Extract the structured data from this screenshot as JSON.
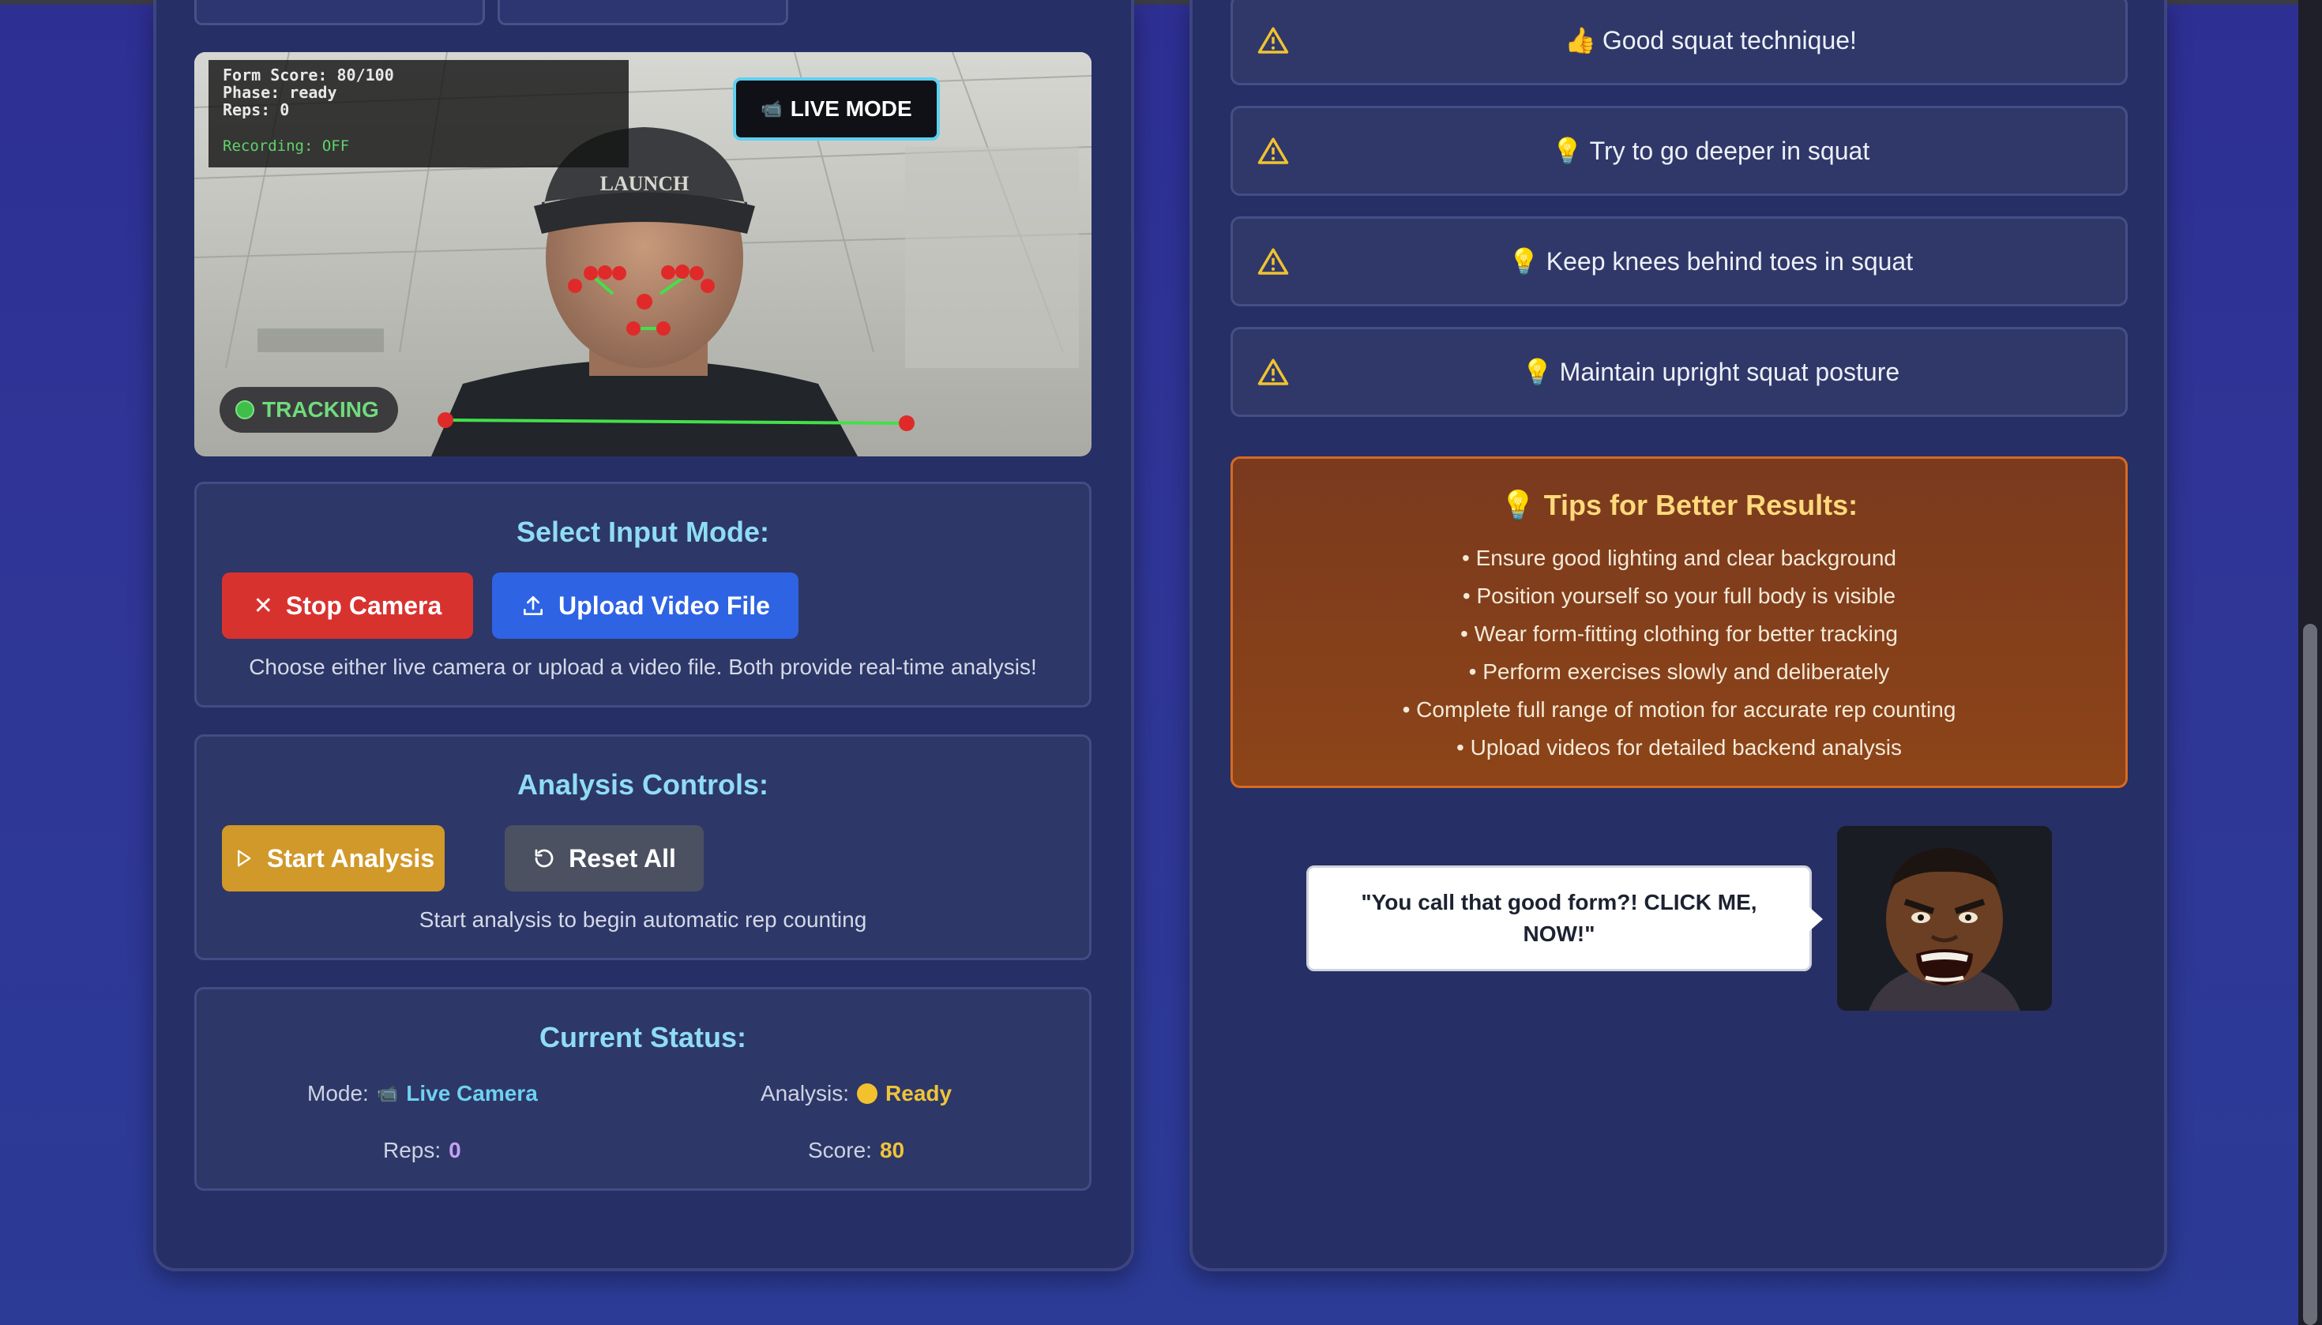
{
  "camera": {
    "overlay": {
      "form_score": "Form Score: 80/100",
      "phase": "Phase: ready",
      "reps": "Reps: 0",
      "recording": "Recording: OFF"
    },
    "live_badge": "LIVE MODE",
    "tracking": "TRACKING"
  },
  "input_mode": {
    "title": "Select Input Mode:",
    "stop_camera": "Stop Camera",
    "upload_video": "Upload Video File",
    "note": "Choose either live camera or upload a video file. Both provide real-time analysis!"
  },
  "analysis_controls": {
    "title": "Analysis Controls:",
    "start": "Start Analysis",
    "reset": "Reset All",
    "note": "Start analysis to begin automatic rep counting"
  },
  "status": {
    "title": "Current Status:",
    "mode_label": "Mode:",
    "mode_value": "Live Camera",
    "analysis_label": "Analysis:",
    "analysis_value": "Ready",
    "reps_label": "Reps:",
    "reps_value": "0",
    "score_label": "Score:",
    "score_value": "80"
  },
  "feedback": [
    {
      "emoji": "👍",
      "text": "Good squat technique!"
    },
    {
      "emoji": "💡",
      "text": "Try to go deeper in squat"
    },
    {
      "emoji": "💡",
      "text": "Keep knees behind toes in squat"
    },
    {
      "emoji": "💡",
      "text": "Maintain upright squat posture"
    }
  ],
  "tips": {
    "title": "Tips for Better Results:",
    "items": [
      "• Ensure good lighting and clear background",
      "• Position yourself so your full body is visible",
      "• Wear form-fitting clothing for better tracking",
      "• Perform exercises slowly and deliberately",
      "• Complete full range of motion for accurate rep counting",
      "• Upload videos for detailed backend analysis"
    ]
  },
  "coach": {
    "quote": "\"You call that good form?! CLICK ME, NOW!\""
  },
  "colors": {
    "accent_cyan": "#8fdcf5",
    "stop_red": "#d8322f",
    "upload_blue": "#2e63e3",
    "start_gold": "#d1982a",
    "tips_orange": "#8d4418"
  }
}
